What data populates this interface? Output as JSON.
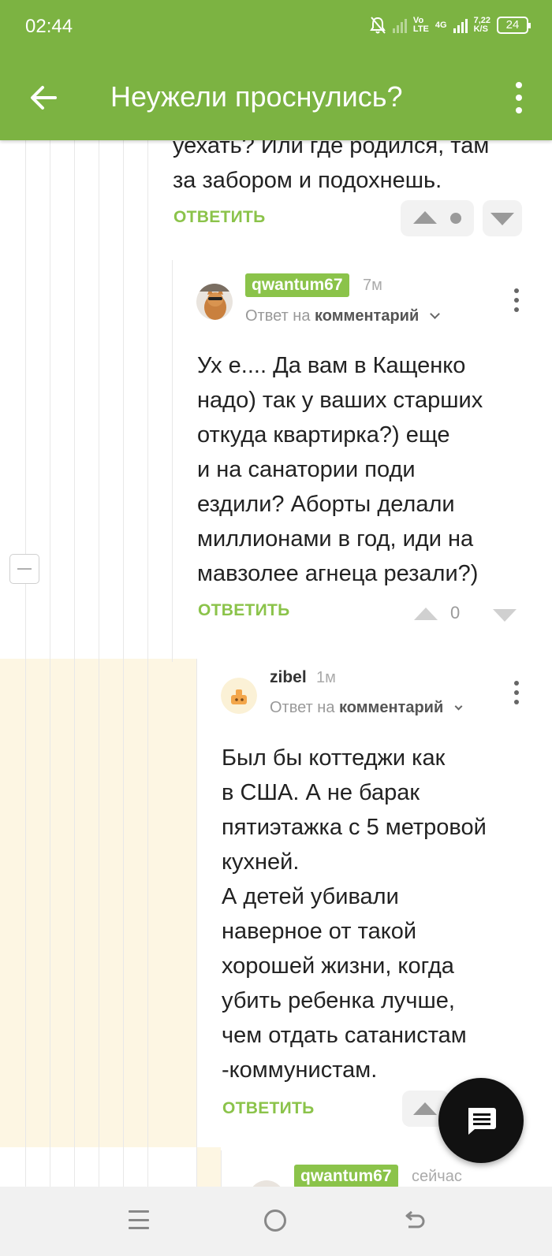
{
  "status_bar": {
    "time": "02:44",
    "volte": [
      "Vo",
      "LTE"
    ],
    "network": [
      "4G",
      ""
    ],
    "speed": [
      "7,22",
      "K/S"
    ],
    "battery": "24"
  },
  "app_bar": {
    "title": "Неужели проснулись?"
  },
  "comments": [
    {
      "text": "уехать? Или где родился, там\nза забором и подохнешь.",
      "reply_label": "ОТВЕТИТЬ"
    },
    {
      "username": "qwantum67",
      "time_ago": "7м",
      "reply_prefix": "Ответ на",
      "reply_target": "комментарий",
      "text": "Ух е.... Да вам в Кащенко\nнадо) так у ваших старших\nоткуда квартирка?) еще\nи на санатории поди\nездили? Аборты делали\nмиллионами в год, иди на\nмавзолее агнеца резали?)",
      "reply_label": "ОТВЕТИТЬ",
      "score": "0"
    },
    {
      "username": "zibel",
      "time_ago": "1м",
      "reply_prefix": "Ответ на",
      "reply_target": "комментарий",
      "text": "Был бы коттеджи как\nв США. А не барак\nпятиэтажка с 5 метровой\nкухней.\nА детей убивали\nнаверное от такой\nхорошей жизни, когда\nубить ребенка лучше,\nчем отдать сатанистам\n-коммунистам.",
      "reply_label": "ОТВЕТИТЬ"
    },
    {
      "username": "qwantum67",
      "time_ago": "сейчас"
    }
  ],
  "colors": {
    "app_bar": "#7cb342",
    "accent": "#8bc34a",
    "highlight": "#fdf6e3"
  }
}
